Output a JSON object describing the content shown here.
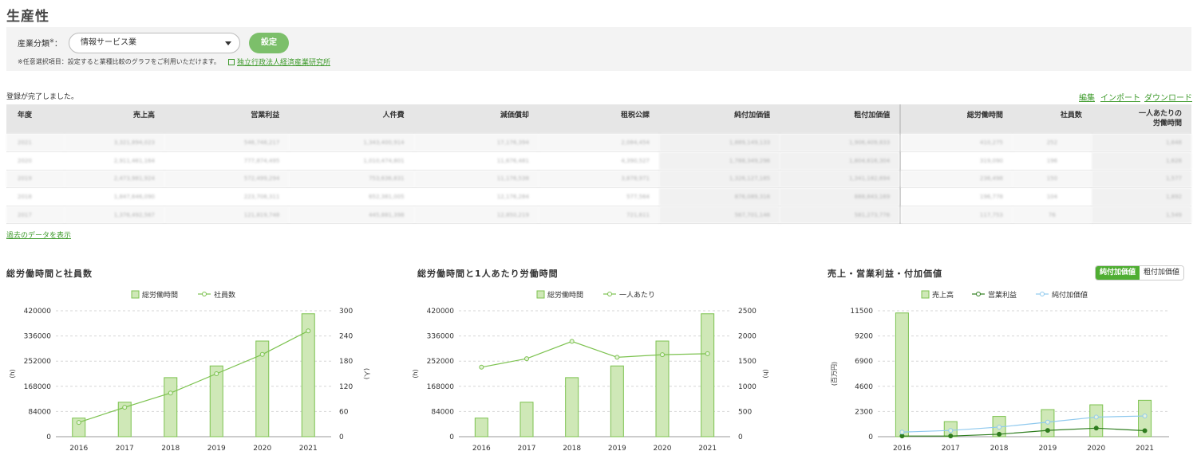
{
  "page": {
    "title": "生産性"
  },
  "filter": {
    "label": "産業分類",
    "label_mark": "※",
    "label_colon": "：",
    "selected": "情報サービス業",
    "button": "設定",
    "note": "※任意選択項目：設定すると業種比較のグラフをご利用いただけます。",
    "link": "独立行政法人経済産業研究所"
  },
  "status": "登録が完了しました。",
  "actions": {
    "edit": "編集",
    "import": "インポート",
    "download": "ダウンロード"
  },
  "table": {
    "headers": [
      "年度",
      "売上高",
      "営業利益",
      "人件費",
      "減価償却",
      "租税公課",
      "純付加価値",
      "粗付加価値",
      "総労働時間",
      "社員数",
      "一人あたりの\n労働時間"
    ],
    "rows": [
      [
        "2021",
        "3,321,894,023",
        "546,748,217",
        "1,343,400,914",
        "17,176,394",
        "2,084,454",
        "1,889,149,133",
        "1,906,409,833",
        "410,275",
        "252",
        "1,648"
      ],
      [
        "2020",
        "2,911,461,164",
        "777,874,495",
        "1,010,474,801",
        "11,676,481",
        "4,390,527",
        "1,788,349,296",
        "1,804,616,304",
        "319,090",
        "196",
        "1,628"
      ],
      [
        "2019",
        "2,473,981,924",
        "572,499,294",
        "753,636,831",
        "11,176,538",
        "3,878,971",
        "1,326,127,185",
        "1,341,182,694",
        "236,498",
        "150",
        "1,577"
      ],
      [
        "2018",
        "1,847,646,090",
        "223,708,311",
        "652,381,005",
        "12,176,284",
        "577,564",
        "876,089,316",
        "888,843,169",
        "196,778",
        "104",
        "1,892"
      ],
      [
        "2017",
        "1,376,492,567",
        "121,819,748",
        "445,881,398",
        "12,850,219",
        "721,611",
        "567,701,146",
        "581,273,776",
        "117,753",
        "76",
        "1,549"
      ]
    ]
  },
  "past_link": "過去のデータを表示",
  "colors": {
    "accent": "#4fae32",
    "bar_fill": "#cfe8b7",
    "bar_stroke": "#7cc24f",
    "line_green": "#7cc24f",
    "dark_green": "#2e7d1e",
    "light_blue": "#8fc9ee"
  },
  "chart_data": [
    {
      "type": "bar+line",
      "title": "総労働時間と社員数",
      "categories": [
        "2016",
        "2017",
        "2018",
        "2019",
        "2020",
        "2021"
      ],
      "series": [
        {
          "name": "総労働時間",
          "kind": "bar",
          "axis": "left",
          "values": [
            62000,
            115000,
            197000,
            236000,
            319000,
            410000
          ]
        },
        {
          "name": "社員数",
          "kind": "line",
          "axis": "right",
          "values": [
            34,
            70,
            104,
            150,
            196,
            252
          ]
        }
      ],
      "ylabel": "(h)",
      "y2label": "(人)",
      "ylim": [
        0,
        420000
      ],
      "yticks": [
        "0",
        "84000",
        "168000",
        "252000",
        "336000",
        "420000"
      ],
      "y2lim": [
        0,
        300
      ],
      "y2ticks": [
        "0",
        "60",
        "120",
        "180",
        "240",
        "300"
      ]
    },
    {
      "type": "bar+line",
      "title": "総労働時間と1人あたり労働時間",
      "categories": [
        "2016",
        "2017",
        "2018",
        "2019",
        "2020",
        "2021"
      ],
      "series": [
        {
          "name": "総労働時間",
          "kind": "bar",
          "axis": "left",
          "values": [
            62000,
            115000,
            197000,
            236000,
            319000,
            410000
          ]
        },
        {
          "name": "一人あたり",
          "kind": "line",
          "axis": "right",
          "values": [
            1380,
            1549,
            1892,
            1577,
            1628,
            1648
          ]
        }
      ],
      "ylabel": "(h)",
      "y2label": "(h)",
      "ylim": [
        0,
        420000
      ],
      "yticks": [
        "0",
        "84000",
        "168000",
        "252000",
        "336000",
        "420000"
      ],
      "y2lim": [
        0,
        2500
      ],
      "y2ticks": [
        "0",
        "500",
        "1000",
        "1500",
        "2000",
        "2500"
      ]
    },
    {
      "type": "bar+line",
      "title": "売上・営業利益・付加価値",
      "categories": [
        "2016",
        "2017",
        "2018",
        "2019",
        "2020",
        "2021"
      ],
      "series": [
        {
          "name": "売上高",
          "kind": "bar",
          "axis": "left",
          "values": [
            11300,
            1376,
            1848,
            2474,
            2911,
            3322
          ]
        },
        {
          "name": "営業利益",
          "kind": "line",
          "axis": "left",
          "values": [
            60,
            60,
            224,
            572,
            778,
            547
          ]
        },
        {
          "name": "純付加価値",
          "kind": "line",
          "axis": "left",
          "values": [
            420,
            568,
            876,
            1326,
            1788,
            1889
          ]
        }
      ],
      "ylabel": "(百万円)",
      "ylim": [
        0,
        11500
      ],
      "yticks": [
        "0",
        "2300",
        "4600",
        "6900",
        "9200",
        "11500"
      ],
      "toggle": {
        "active": "純付加価値",
        "inactive": "粗付加価値"
      }
    }
  ]
}
